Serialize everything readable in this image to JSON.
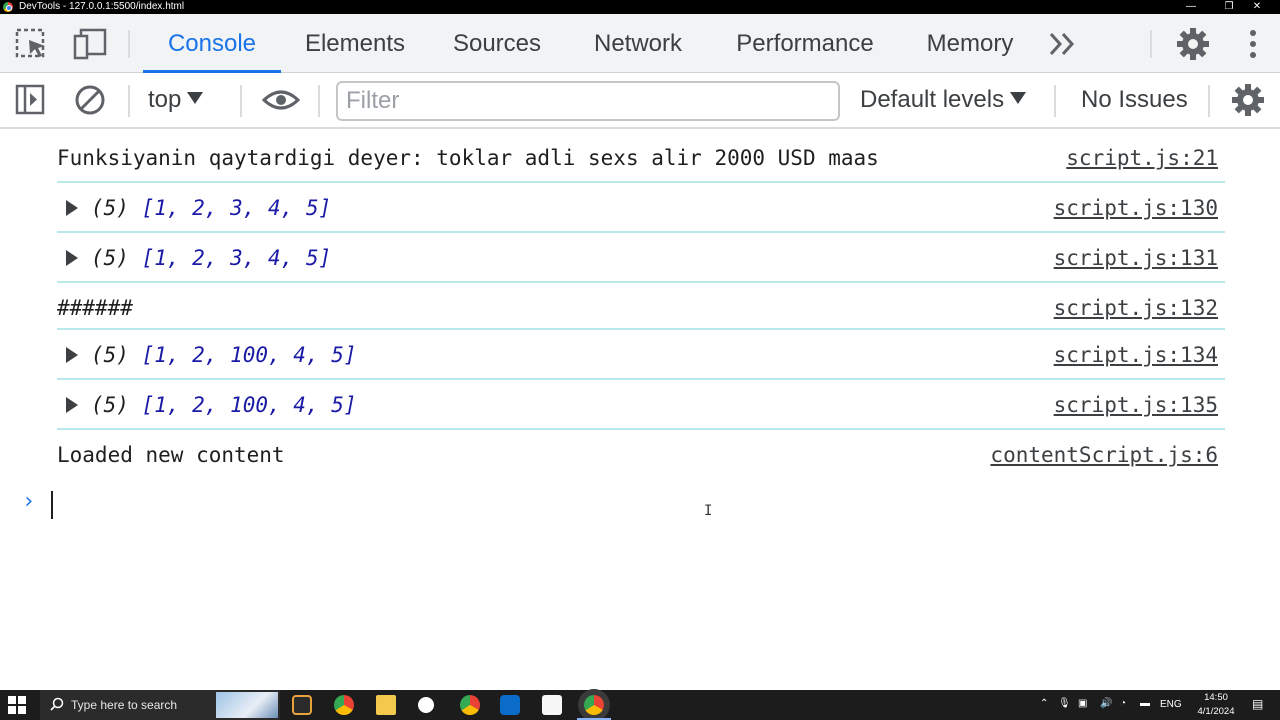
{
  "window": {
    "title": "DevTools - 127.0.0.1:5500/index.html"
  },
  "tabs": [
    {
      "label": "Console",
      "active": true
    },
    {
      "label": "Elements"
    },
    {
      "label": "Sources"
    },
    {
      "label": "Network"
    },
    {
      "label": "Performance"
    },
    {
      "label": "Memory"
    }
  ],
  "toolbar": {
    "context": "top",
    "filter_placeholder": "Filter",
    "levels": "Default levels",
    "issues": "No Issues"
  },
  "messages": [
    {
      "text": "Funksiyanin qaytardigi deyer: toklar adli sexs alir 2000 USD maas",
      "source": "script.js:21",
      "expandable": false
    },
    {
      "prefix": "(5) ",
      "array": "[1, 2, 3, 4, 5]",
      "source": "script.js:130",
      "expandable": true
    },
    {
      "prefix": "(5) ",
      "array": "[1, 2, 3, 4, 5]",
      "source": "script.js:131",
      "expandable": true
    },
    {
      "text": "######",
      "source": "script.js:132",
      "expandable": false
    },
    {
      "prefix": "(5) ",
      "array": "[1, 2, 100, 4, 5]",
      "source": "script.js:134",
      "expandable": true
    },
    {
      "prefix": "(5) ",
      "array": "[1, 2, 100, 4, 5]",
      "source": "script.js:135",
      "expandable": true
    },
    {
      "text": "Loaded new content",
      "source": "contentScript.js:6",
      "expandable": false
    }
  ],
  "taskbar": {
    "search_placeholder": "Type here to search",
    "language": "ENG",
    "time": "14:50",
    "date": "4/1/2024"
  },
  "colors": {
    "accent": "#1a73e8",
    "row_separator": "#b9e9ea"
  }
}
